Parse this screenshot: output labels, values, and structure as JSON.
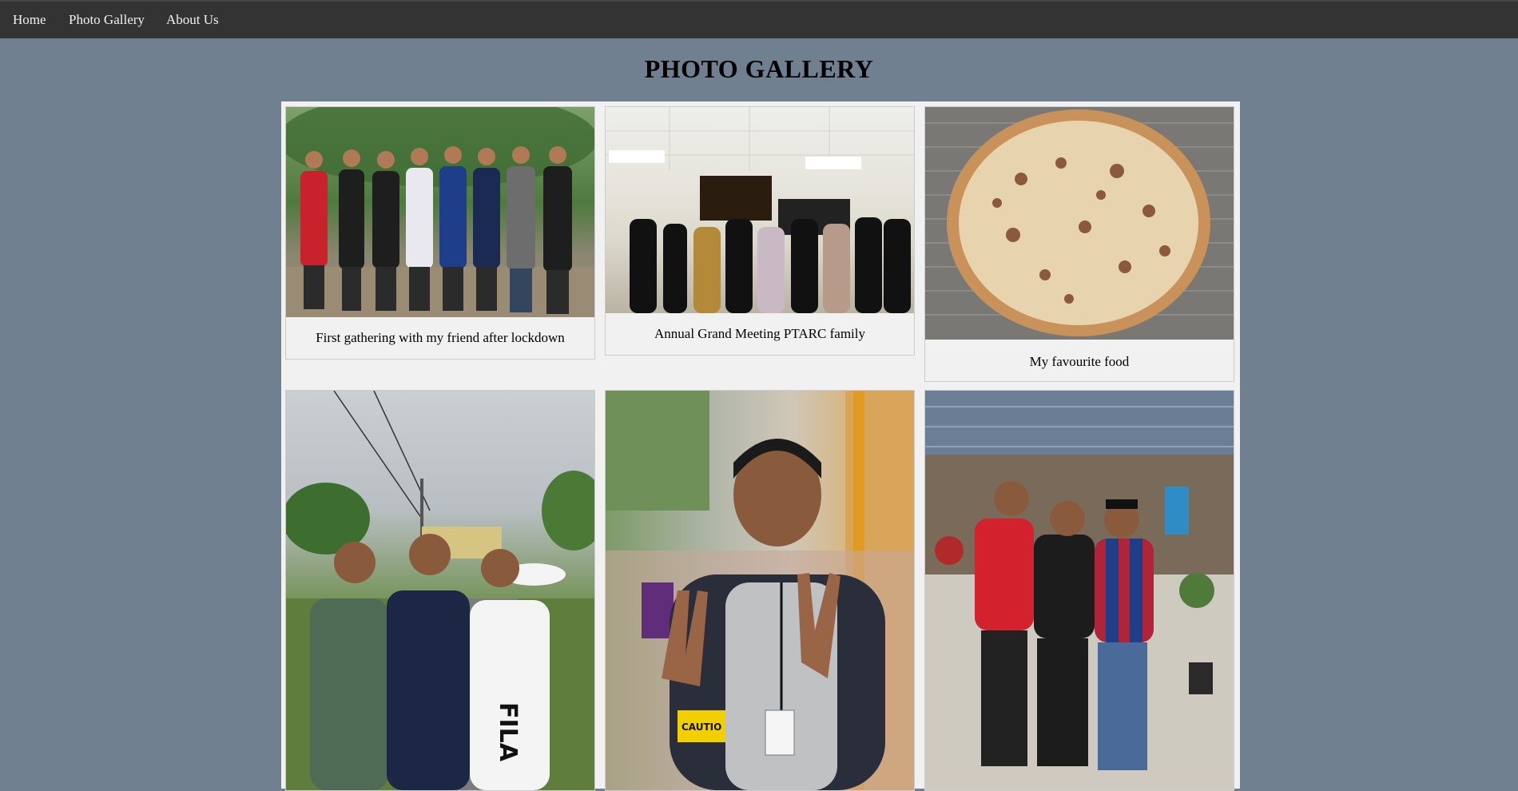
{
  "nav": {
    "items": [
      {
        "label": "Home"
      },
      {
        "label": "Photo Gallery"
      },
      {
        "label": "About Us"
      }
    ]
  },
  "page": {
    "title": "PHOTO GALLERY"
  },
  "gallery": {
    "cards": [
      {
        "caption": "First gathering with my friend after lockdown",
        "image": "group-friends-outdoors-photo"
      },
      {
        "caption": "Annual Grand Meeting PTARC family",
        "image": "group-meeting-indoors-photo"
      },
      {
        "caption": "My favourite food",
        "image": "pizza-photo"
      },
      {
        "caption": "",
        "image": "three-friends-roadside-photo"
      },
      {
        "caption": "",
        "image": "peace-sign-portrait-photo"
      },
      {
        "caption": "",
        "image": "three-friends-porch-photo"
      }
    ]
  },
  "colors": {
    "background": "#708090",
    "navbar": "#333333",
    "panel": "#f1f1f1"
  }
}
